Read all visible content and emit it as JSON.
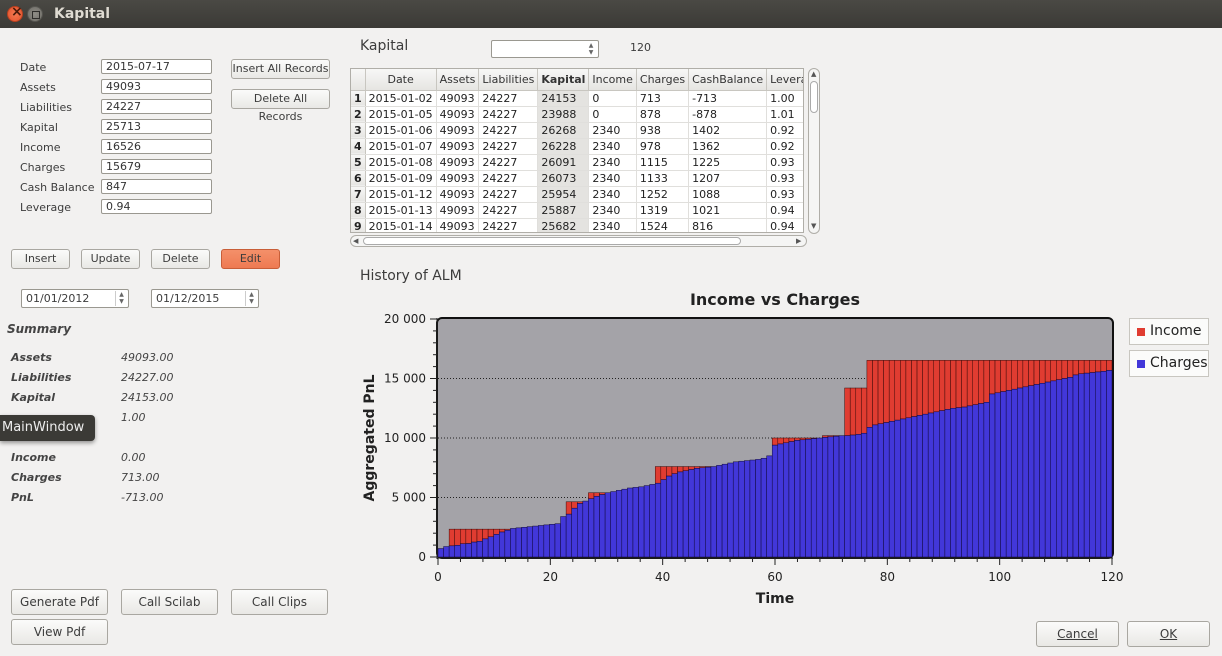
{
  "window": {
    "title": "Kapital"
  },
  "form": {
    "fields": [
      {
        "label": "Date",
        "value": "2015-07-17"
      },
      {
        "label": "Assets",
        "value": "49093"
      },
      {
        "label": "Liabilities",
        "value": "24227"
      },
      {
        "label": "Kapital",
        "value": "25713"
      },
      {
        "label": "Income",
        "value": "16526"
      },
      {
        "label": "Charges",
        "value": "15679"
      },
      {
        "label": "Cash Balance",
        "value": "847"
      },
      {
        "label": "Leverage",
        "value": "0.94"
      }
    ],
    "insert_all_label": "Insert All Records",
    "delete_all_label": "Delete All Records"
  },
  "actions": {
    "insert": "Insert",
    "update": "Update",
    "delete": "Delete",
    "edit": "Edit"
  },
  "date_range": {
    "from": "01/01/2012",
    "to": "01/12/2015"
  },
  "summary": {
    "title": "Summary",
    "rows": [
      {
        "label": "Assets",
        "value": "49093.00"
      },
      {
        "label": "Liabilities",
        "value": "24227.00"
      },
      {
        "label": "Kapital",
        "value": "24153.00"
      },
      {
        "label": "",
        "value": "1.00"
      },
      {
        "label": "Income",
        "value": "0.00"
      },
      {
        "label": "Charges",
        "value": "713.00"
      },
      {
        "label": "PnL",
        "value": "-713.00"
      }
    ]
  },
  "tooltip": "MainWindow",
  "bottom_buttons": {
    "generate_pdf": "Generate Pdf",
    "call_scilab": "Call Scilab",
    "call_clips": "Call Clips",
    "view_pdf": "View Pdf",
    "cancel": "Cancel",
    "ok": "OK"
  },
  "table_panel": {
    "title": "Kapital",
    "combo_value": "",
    "count": "120",
    "columns": [
      "Date",
      "Assets",
      "Liabilities",
      "Kapital",
      "Income",
      "Charges",
      "CashBalance",
      "Levera"
    ],
    "rows": [
      [
        "1",
        "2015-01-02",
        "49093",
        "24227",
        "24153",
        "0",
        "713",
        "-713",
        "1.00"
      ],
      [
        "2",
        "2015-01-05",
        "49093",
        "24227",
        "23988",
        "0",
        "878",
        "-878",
        "1.01"
      ],
      [
        "3",
        "2015-01-06",
        "49093",
        "24227",
        "26268",
        "2340",
        "938",
        "1402",
        "0.92"
      ],
      [
        "4",
        "2015-01-07",
        "49093",
        "24227",
        "26228",
        "2340",
        "978",
        "1362",
        "0.92"
      ],
      [
        "5",
        "2015-01-08",
        "49093",
        "24227",
        "26091",
        "2340",
        "1115",
        "1225",
        "0.93"
      ],
      [
        "6",
        "2015-01-09",
        "49093",
        "24227",
        "26073",
        "2340",
        "1133",
        "1207",
        "0.93"
      ],
      [
        "7",
        "2015-01-12",
        "49093",
        "24227",
        "25954",
        "2340",
        "1252",
        "1088",
        "0.93"
      ],
      [
        "8",
        "2015-01-13",
        "49093",
        "24227",
        "25887",
        "2340",
        "1319",
        "1021",
        "0.94"
      ],
      [
        "9",
        "2015-01-14",
        "49093",
        "24227",
        "25682",
        "2340",
        "1524",
        "816",
        "0.94"
      ]
    ]
  },
  "history_label": "History of ALM",
  "colors": {
    "income": "#e03c31",
    "charges": "#4237d9",
    "plot_bg": "#a4a3a8",
    "accent_orange": "#ee7a52"
  },
  "chart_data": {
    "type": "bar",
    "title": "Income vs Charges",
    "xlabel": "Time",
    "ylabel": "Aggregated PnL",
    "xlim": [
      0,
      120
    ],
    "ylim": [
      0,
      20000
    ],
    "xticks": [
      "0",
      "20",
      "40",
      "60",
      "80",
      "100",
      "120"
    ],
    "yticks": [
      "0",
      "5 000",
      "10 000",
      "15 000",
      "20 000"
    ],
    "grid": "horizontal dotted",
    "legend_position": "right",
    "series": [
      {
        "name": "Income",
        "values": [
          0,
          0,
          2340,
          2340,
          2340,
          2340,
          2340,
          2340,
          2340,
          2340,
          2340,
          2340,
          2340,
          2340,
          2340,
          2340,
          2340,
          2340,
          2340,
          2340,
          2340,
          2340,
          2340,
          4640,
          4640,
          4640,
          4640,
          5400,
          5400,
          5400,
          5400,
          5400,
          5400,
          5400,
          5400,
          5400,
          5400,
          5400,
          5400,
          7600,
          7600,
          7600,
          7600,
          7600,
          7600,
          7600,
          7600,
          7600,
          7600,
          7600,
          7600,
          7600,
          7600,
          7600,
          7600,
          7600,
          7600,
          7600,
          7600,
          7600,
          10000,
          10000,
          10000,
          10000,
          10000,
          10000,
          10000,
          10000,
          10000,
          10200,
          10200,
          10200,
          10200,
          14200,
          14200,
          14200,
          14200,
          16526,
          16526,
          16526,
          16526,
          16526,
          16526,
          16526,
          16526,
          16526,
          16526,
          16526,
          16526,
          16526,
          16526,
          16526,
          16526,
          16526,
          16526,
          16526,
          16526,
          16526,
          16526,
          16526,
          16526,
          16526,
          16526,
          16526,
          16526,
          16526,
          16526,
          16526,
          16526,
          16526,
          16526,
          16526,
          16526,
          16526,
          16526,
          16526,
          16526,
          16526,
          16526,
          16526,
          16526
        ]
      },
      {
        "name": "Charges",
        "values": [
          713,
          878,
          938,
          978,
          1115,
          1133,
          1252,
          1319,
          1524,
          1700,
          1900,
          2100,
          2250,
          2400,
          2450,
          2500,
          2550,
          2600,
          2650,
          2700,
          2750,
          2800,
          3400,
          3600,
          4100,
          4500,
          4700,
          4900,
          5100,
          5250,
          5400,
          5500,
          5600,
          5700,
          5800,
          5850,
          5900,
          6000,
          6100,
          6200,
          6500,
          6800,
          7000,
          7150,
          7250,
          7350,
          7450,
          7500,
          7550,
          7600,
          7700,
          7800,
          7900,
          8000,
          8050,
          8100,
          8150,
          8200,
          8300,
          8500,
          9400,
          9500,
          9600,
          9700,
          9800,
          9850,
          9900,
          9950,
          10000,
          10050,
          10100,
          10150,
          10200,
          10200,
          10250,
          10300,
          10400,
          10900,
          11100,
          11200,
          11300,
          11400,
          11500,
          11600,
          11700,
          11800,
          11900,
          12000,
          12100,
          12200,
          12300,
          12400,
          12500,
          12550,
          12600,
          12700,
          12800,
          12900,
          13000,
          13700,
          13800,
          13900,
          14000,
          14100,
          14200,
          14300,
          14400,
          14500,
          14600,
          14700,
          14800,
          14900,
          15000,
          15100,
          15300,
          15400,
          15450,
          15500,
          15550,
          15600,
          15679
        ]
      }
    ]
  }
}
